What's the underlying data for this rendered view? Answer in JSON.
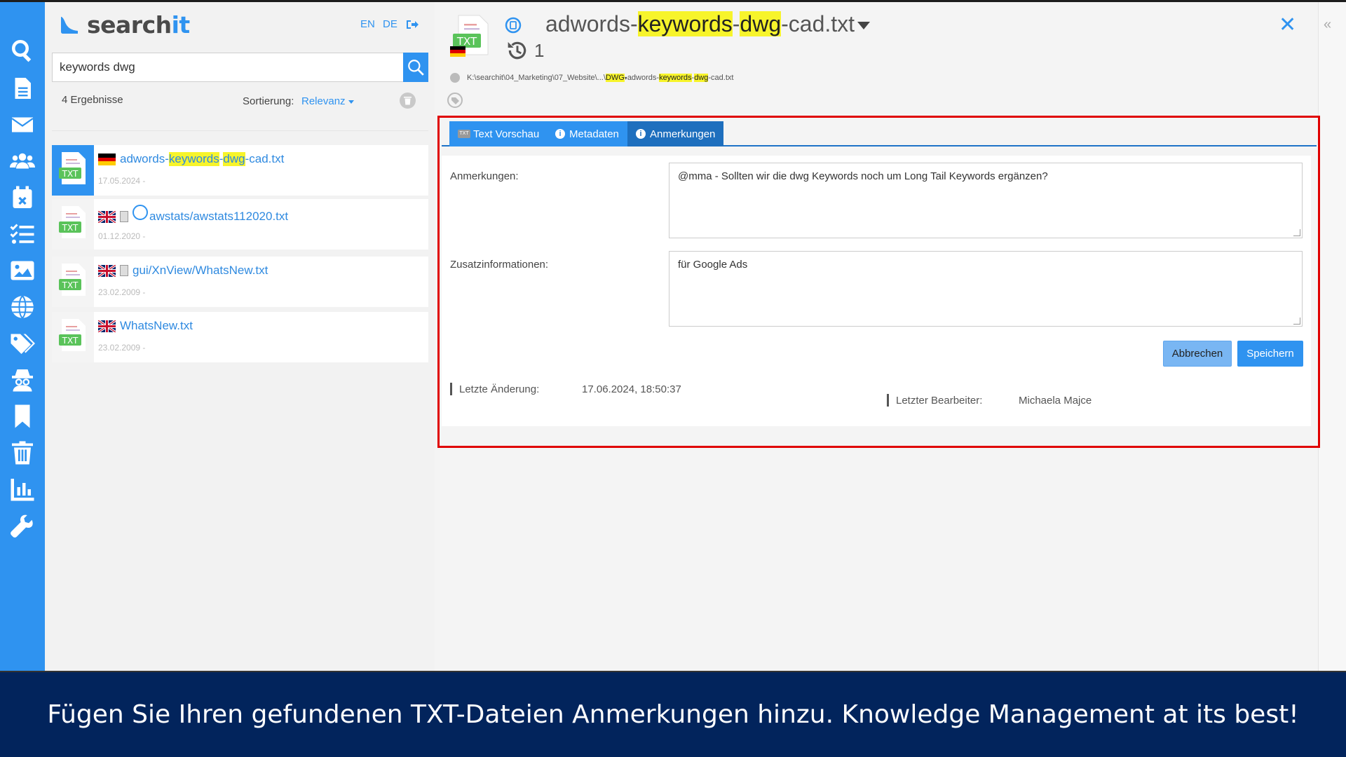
{
  "app": {
    "logo_part1": "search",
    "logo_part2": "it",
    "lang_en": "EN",
    "lang_de": "DE"
  },
  "rail": {
    "icons": [
      "search-icon",
      "document-icon",
      "mail-icon",
      "users-icon",
      "calendar-icon",
      "checklist-icon",
      "image-icon",
      "globe-icon",
      "tags-icon",
      "spy-icon",
      "bookmark-icon",
      "trash-icon",
      "chart-icon",
      "wrench-icon"
    ]
  },
  "search": {
    "value": "keywords dwg",
    "result_count": "4 Ergebnisse",
    "sort_label": "Sortierung:",
    "sort_value": "Relevanz"
  },
  "results": [
    {
      "pre": "adwords-",
      "hl1": "keywords",
      "mid": "-",
      "hl2": "dwg",
      "post": "-cad.txt",
      "date": "17.05.2024 -",
      "flag": "de"
    },
    {
      "text": "awstats/awstats112020.txt",
      "date": "01.12.2020 -",
      "flag": "uk"
    },
    {
      "text": "gui/XnView/WhatsNew.txt",
      "date": "23.02.2009 -",
      "flag": "uk"
    },
    {
      "text": "WhatsNew.txt",
      "date": "23.02.2009 -",
      "flag": "uk"
    }
  ],
  "detail": {
    "title_pre": "adwords-",
    "title_hl1": "keywords",
    "title_mid": "-",
    "title_hl2": "dwg",
    "title_post": "-cad.txt",
    "history_count": "1",
    "path_pre": "K:\\searchit\\04_Marketing\\07_Website\\...\\",
    "path_hl_dir": "DWG",
    "path_file_pre": "adwords-",
    "path_file_hl1": "keywords",
    "path_file_mid": "-",
    "path_file_hl2": "dwg",
    "path_file_post": "-cad.txt",
    "file_badge": "TXT"
  },
  "tabs": [
    {
      "label": "Text Vorschau",
      "badge": "TXT"
    },
    {
      "label": "Metadaten",
      "badge": "i"
    },
    {
      "label": "Anmerkungen",
      "badge": "i"
    }
  ],
  "notes": {
    "anmerkungen_label": "Anmerkungen:",
    "anmerkungen_value": "@mma - Sollten wir die dwg Keywords noch um Long Tail Keywords ergänzen?",
    "zusatz_label": "Zusatzinformationen:",
    "zusatz_value": "für Google Ads",
    "cancel_label": "Abbrechen",
    "save_label": "Speichern",
    "last_change_label": "Letzte Änderung:",
    "last_change_value": "17.06.2024, 18:50:37",
    "last_editor_label": "Letzter Bearbeiter:",
    "last_editor_value": "Michaela Majce"
  },
  "caption": "Fügen Sie Ihren gefundenen TXT-Dateien Anmerkungen hinzu. Knowledge Management at its best!",
  "colors": {
    "accent": "#2f93f0",
    "highlight": "#f7f42b",
    "frame": "#e00000",
    "banner": "#02245c"
  }
}
